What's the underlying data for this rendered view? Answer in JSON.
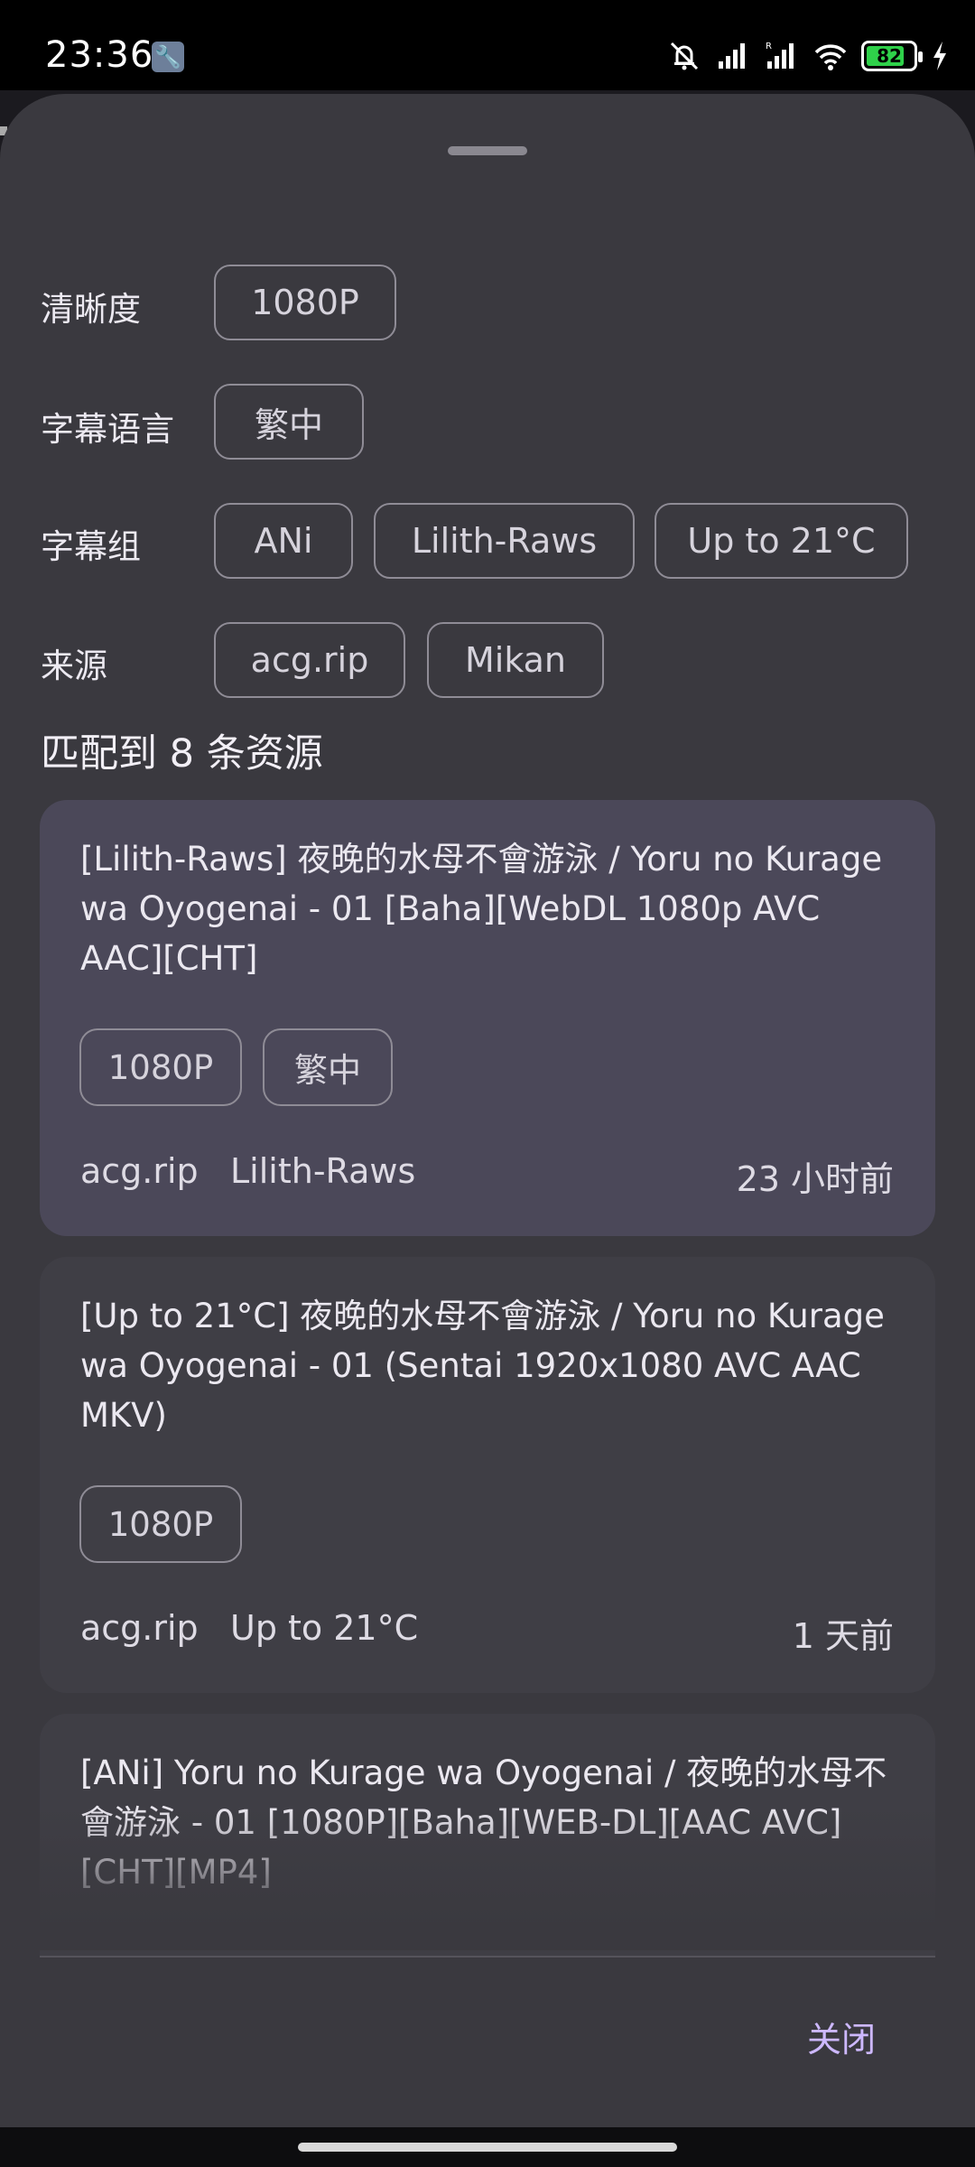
{
  "status_bar": {
    "time": "23:36",
    "battery": "82",
    "battery_level": 0.82
  },
  "filters": [
    {
      "label": "清晰度",
      "options": [
        "1080P"
      ]
    },
    {
      "label": "字幕语言",
      "options": [
        "繁中"
      ]
    },
    {
      "label": "字幕组",
      "options": [
        "ANi",
        "Lilith-Raws",
        "Up to 21°C"
      ]
    },
    {
      "label": "来源",
      "options": [
        "acg.rip",
        "Mikan"
      ]
    }
  ],
  "results_title": "匹配到 8 条资源",
  "cards": [
    {
      "title": "[Lilith-Raws] 夜晚的水母不會游泳 / Yoru no Kurage wa Oyogenai - 01 [Baha][WebDL 1080p AVC AAC][CHT]",
      "tags": [
        "1080P",
        "繁中"
      ],
      "source": "acg.rip",
      "group": "Lilith-Raws",
      "time": "23 小时前"
    },
    {
      "title": "[Up to 21°C] 夜晚的水母不會游泳 / Yoru no Kurage wa Oyogenai - 01 (Sentai 1920x1080 AVC AAC MKV)",
      "tags": [
        "1080P"
      ],
      "source": "acg.rip",
      "group": "Up to 21°C",
      "time": "1 天前"
    },
    {
      "title": "[ANi] Yoru no Kurage wa Oyogenai /  夜晚的水母不會游泳 - 01 [1080P][Baha][WEB-DL][AAC AVC][CHT][MP4]"
    }
  ],
  "close_label": "关闭",
  "colors": {
    "sheet": "#3a393f",
    "selected_card": "#4b4859",
    "accent": "#cdb8ff"
  }
}
